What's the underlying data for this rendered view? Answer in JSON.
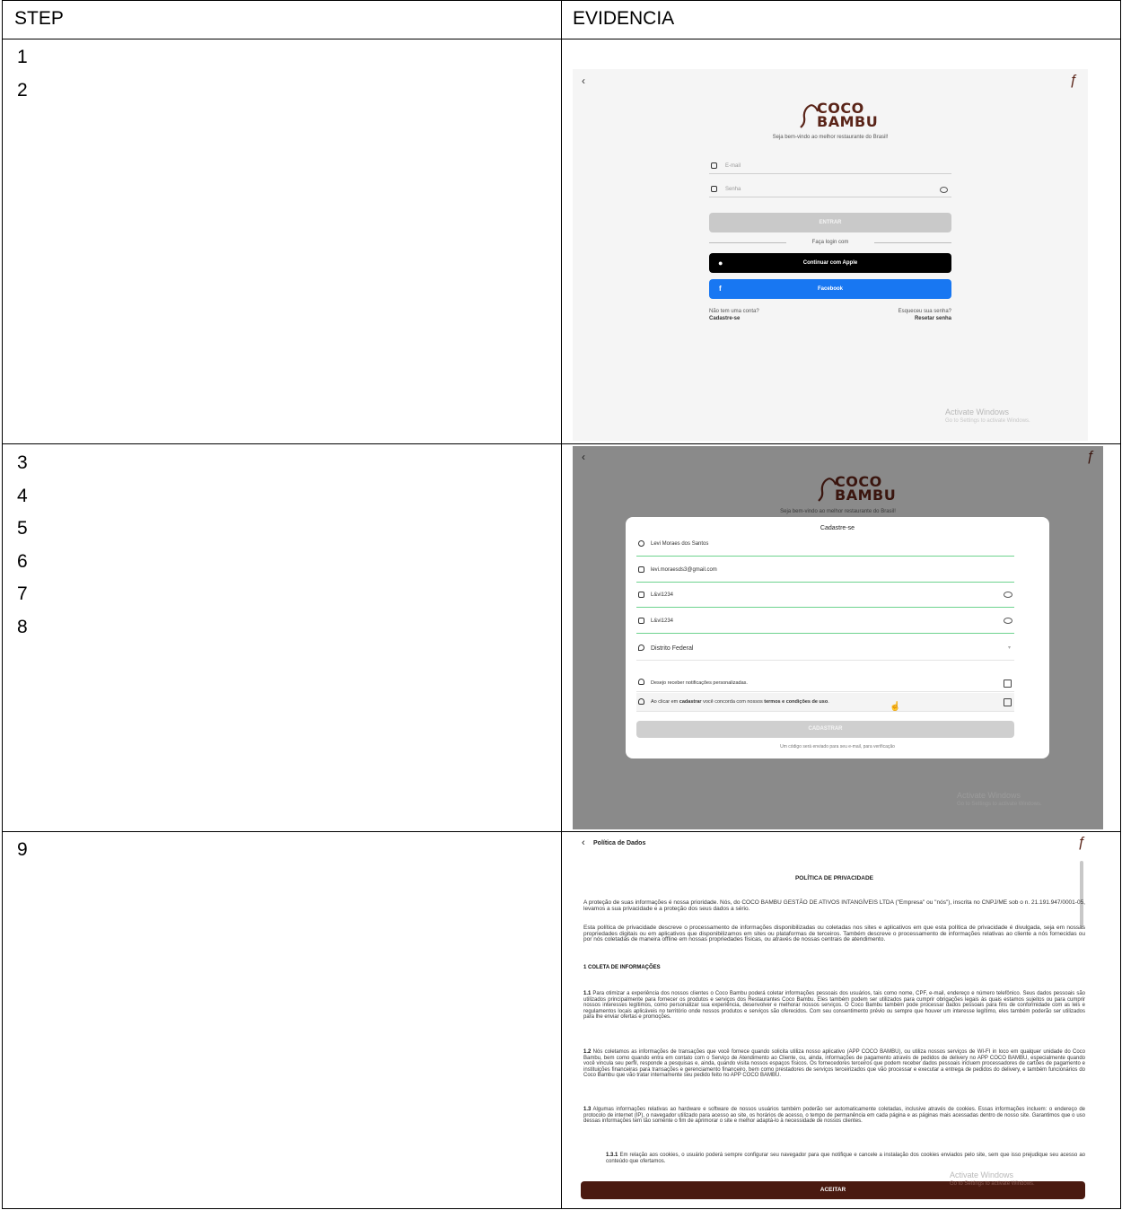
{
  "table": {
    "header_step": "STEP",
    "header_evidence": "EVIDENCIA",
    "rows": [
      {
        "steps": [
          "1",
          "2"
        ]
      },
      {
        "steps": [
          "3",
          "4",
          "5",
          "6",
          "7",
          "8"
        ]
      },
      {
        "steps": [
          "9"
        ]
      }
    ]
  },
  "login_screen": {
    "logo_line1": "COCO",
    "logo_line2": "BAMBU",
    "tagline": "Seja bem-vindo ao melhor restaurante do Brasil!",
    "email_placeholder": "E-mail",
    "password_placeholder": "Senha",
    "enter_button": "ENTRAR",
    "divider_text": "Faça login com",
    "apple_button": "Continuar com Apple",
    "facebook_button": "Facebook",
    "no_account": "Não tem uma conta?",
    "register_link": "Cadastre-se",
    "forgot": "Esqueceu sua senha?",
    "reset_link": "Resetar senha",
    "activate_title": "Activate Windows",
    "activate_sub": "Go to Settings to activate Windows."
  },
  "register_screen": {
    "logo_line1": "COCO",
    "logo_line2": "BAMBU",
    "tagline": "Seja bem-vindo ao melhor restaurante do Brasil!",
    "modal_title": "Cadastre-se",
    "name_value": "Levi Moraes dos Santos",
    "email_value": "levi.moraesds3@gmail.com",
    "password_value": "L&vi1234",
    "confirm_value": "L&vi1234",
    "state_value": "Distrito Federal",
    "notifications_label": "Desejo receber notificações personalizadas.",
    "terms_prefix": "Ao clicar em ",
    "terms_bold1": "cadastrar",
    "terms_middle": " você concorda com nossos ",
    "terms_bold2": "termos e condições de uso",
    "terms_suffix": ".",
    "register_button": "CADASTRAR",
    "verification_note": "Um código será enviado para seu e-mail, para verificação",
    "activate_title": "Activate Windows",
    "activate_sub": "Go to Settings to activate Windows."
  },
  "policy_screen": {
    "header_title": "Política de Dados",
    "doc_title": "POLÍTICA DE PRIVACIDADE",
    "p1": "A proteção de suas informações é nossa prioridade. Nós, do COCO BAMBU GESTÃO DE ATIVOS INTANGÍVEIS LTDA (\"Empresa\" ou \"nós\"), inscrita no CNPJ/ME sob o n. 21.191.947/0001-05, levamos a sua privacidade e a proteção dos seus dados a sério.",
    "p2": "Esta política de privacidade descreve o processamento de informações disponibilizadas ou coletadas nos sites e aplicativos em que esta política de privacidade é divulgada, seja em nossas propriedades digitais ou em aplicativos que disponibilizamos em sites ou plataformas de terceiros. Também descreve o processamento de informações relativas ao cliente a nós fornecidas ou por nós coletadas de maneira offline em nossas propriedades físicas, ou através de nossas centrais de atendimento.",
    "section1": "1 COLETA DE INFORMAÇÕES",
    "p11_num": "1.1",
    "p11": " Para otimizar a experiência dos nossos clientes o Coco Bambu poderá coletar informações pessoais dos usuários, tais como nome, CPF, e-mail, endereço e número telefônico. Seus dados pessoais são utilizados principalmente para fornecer os produtos e serviços dos Restaurantes Coco Bambu. Eles também podem ser utilizados para cumprir obrigações legais às quais estamos sujeitos ou para cumprir nossos interesses legítimos, como personalizar sua experiência, desenvolver e melhorar nossos serviços. O Coco Bambu também pode processar dados pessoais para fins de conformidade com as leis e regulamentos locais aplicáveis no território onde nossos produtos e serviços são oferecidos. Com seu consentimento prévio ou sempre que houver um interesse legítimo, eles também poderão ser utilizados para lhe enviar ofertas e promoções.",
    "p12_num": "1.2",
    "p12": " Nós coletamos as informações de transações que você fornece quando solicita utiliza nosso aplicativo (APP COCO BAMBU), ou utiliza nossos serviços de WI-FI in loco em qualquer unidade do Coco Bambu, bem como quando entra em contato com o Serviço de Atendimento ao Cliente, ou, ainda, informações de pagamento através de pedidos de delivery no APP COCO BAMBU, especialmente quando você vincula seu perfil, responde a pesquisas e, ainda, quando visita nossos espaços físicos. Os fornecedores terceiros que podem receber dados pessoais incluem processadores de cartões de pagamento e instituições financeiras para transações e gerenciamento financeiro, bem como prestadores de serviços terceirizados que vão processar e executar a entrega de pedidos do delivery, e também funcionários do Coco Bambu que vão tratar internamente seu pedido feito no APP COCO BAMBU.",
    "p13_num": "1.3",
    "p13": " Algumas informações relativas ao hardware e software de nossos usuários também poderão ser automaticamente coletadas, inclusive através de cookies. Essas informações incluem: o endereço de protocolo de internet (IP), o navegador utilizado para acesso ao site, os horários de acesso, o tempo de permanência em cada página e as páginas mais acessadas dentro de nosso site. Garantimos que o uso dessas informações tem tão somente o fim de aprimorar o site e melhor adaptá-lo à necessidade de nossos clientes.",
    "p131_num": "1.3.1",
    "p131": " Em relação aos cookies, o usuário poderá sempre configurar seu navegador para que notifique e cancele a instalação dos cookies enviados pelo site, sem que isso prejudique seu acesso ao conteúdo que ofertamos.",
    "accept_button": "ACEITAR",
    "activate_title": "Activate Windows",
    "activate_sub": "Go to Settings to activate Windows."
  },
  "colors": {
    "brand_brown": "#5a2418",
    "accept_brown": "#4a1a10",
    "facebook_blue": "#1877f2",
    "apple_black": "#000000",
    "field_green": "#6fd38f",
    "overlay_gray": "#8a8a8a"
  }
}
